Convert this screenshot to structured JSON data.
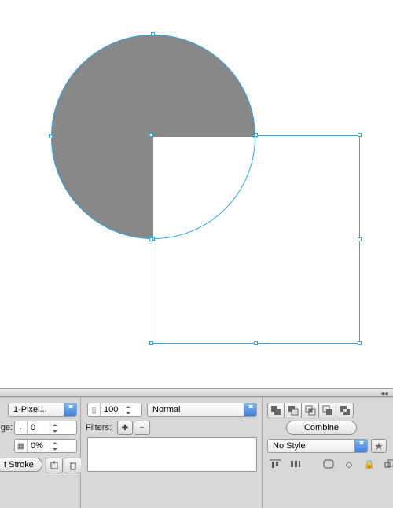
{
  "canvas": {
    "circle": {
      "fill": "#888888",
      "selection": "#2aa8e5"
    },
    "square": {
      "selection": "#2aa8e5"
    }
  },
  "left_panel": {
    "stroke_preset": "1-Pixel...",
    "edge_label": "ge:",
    "edge_value": "0",
    "texture_value": "0%",
    "stroke_btn": "t Stroke"
  },
  "mid_panel": {
    "opacity_value": "100",
    "blend_mode": "Normal",
    "filters_label": "Filters:"
  },
  "right_panel": {
    "combine_btn": "Combine",
    "style_select": "No Style"
  }
}
